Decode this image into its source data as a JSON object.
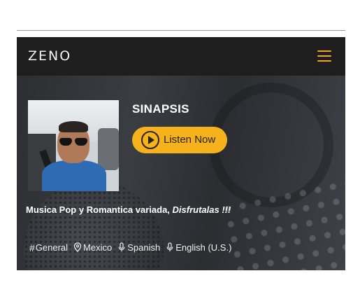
{
  "navbar": {
    "logo_text": "ZENO",
    "menu_icon": "hamburger-menu-icon",
    "accent_color": "#f2a623"
  },
  "station": {
    "title": "SINAPSIS",
    "listen_button_label": "Listen Now",
    "listen_button_color": "#f5b21c",
    "description_main": "Musica Pop y Romantica variada, ",
    "description_emphasis": "Disfrutalas !!!"
  },
  "tags": [
    {
      "icon": "hash-icon",
      "label": "General"
    },
    {
      "icon": "location-pin-icon",
      "label": "Mexico"
    },
    {
      "icon": "microphone-icon",
      "label": "Spanish"
    },
    {
      "icon": "microphone-icon",
      "label": "English (U.S.)"
    }
  ]
}
